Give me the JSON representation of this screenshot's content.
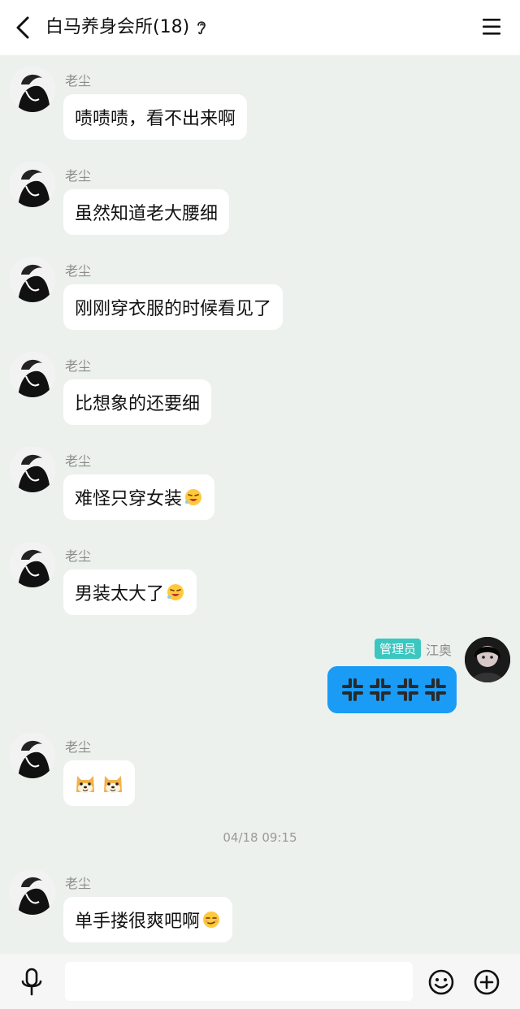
{
  "header": {
    "title": "白马养身会所(18)"
  },
  "messages": [
    {
      "sender": "老尘",
      "text": "啧啧啧，看不出来啊",
      "emoji": ""
    },
    {
      "sender": "老尘",
      "text": "虽然知道老大腰细",
      "emoji": ""
    },
    {
      "sender": "老尘",
      "text": "刚刚穿衣服的时候看见了",
      "emoji": ""
    },
    {
      "sender": "老尘",
      "text": "比想象的还要细",
      "emoji": ""
    },
    {
      "sender": "老尘",
      "text": "难怪只穿女装",
      "emoji": "laugh-emoji"
    },
    {
      "sender": "老尘",
      "text": "男装太大了",
      "emoji": "laugh-emoji"
    },
    {
      "sender": "老尘",
      "text": "",
      "emoji": "doge-emoji"
    },
    {
      "sender": "老尘",
      "text": "单手搂很爽吧啊",
      "emoji": "smirk-emoji"
    }
  ],
  "admin_message": {
    "badge": "管理员",
    "name": "江奥",
    "content_icon": "anger-icon"
  },
  "timestamp": "04/18 09:15",
  "input": {
    "placeholder": "",
    "value": ""
  },
  "colors": {
    "background": "#edf1ee",
    "bubble": "#ffffff",
    "bubble_self": "#1a9bf5",
    "admin_badge": "#3cc6c0"
  }
}
